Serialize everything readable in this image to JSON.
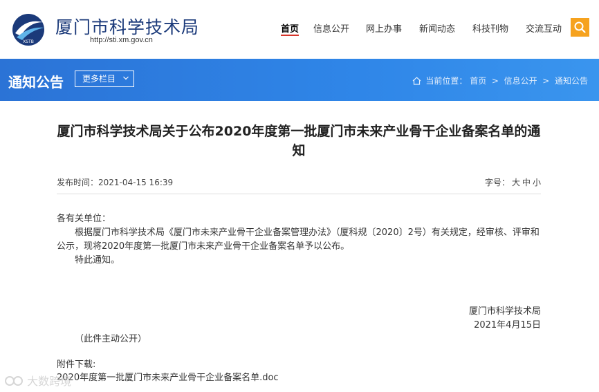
{
  "header": {
    "site_title": "厦门市科学技术局",
    "site_url": "http://sti.xm.gov.cn",
    "logo_text": "XSTB",
    "nav": [
      {
        "label": "首页",
        "active": true
      },
      {
        "label": "信息公开",
        "active": false
      },
      {
        "label": "网上办事",
        "active": false
      },
      {
        "label": "新闻动态",
        "active": false
      },
      {
        "label": "科技刊物",
        "active": false
      },
      {
        "label": "交流互动",
        "active": false
      }
    ],
    "search_icon": "search-icon",
    "accent_color": "#f6a21e",
    "active_underline_color": "#d6342a"
  },
  "banner": {
    "title": "通知公告",
    "more_label": "更多栏目",
    "breadcrumb_prefix": "当前位置：",
    "breadcrumb": [
      "首页",
      "信息公开",
      "通知公告"
    ],
    "separator": ">",
    "color": "#2f86e8"
  },
  "article": {
    "title": "厦门市科学技术局关于公布2020年度第一批厦门市未来产业骨干企业备案名单的通知",
    "publish_time": "发布时间：2021-04-15 16:39",
    "font_size_label": "字号：",
    "font_sizes": [
      "大",
      "中",
      "小"
    ],
    "salutation": "各有关单位：",
    "paragraph_1": "根据厦门市科学技术局《厦门市未来产业骨干企业备案管理办法》（厦科规〔2020〕2号）有关规定，经审核、评审和公示，现将2020年度第一批厦门市未来产业骨干企业备案名单予以公布。",
    "paragraph_2": "特此通知。",
    "signature_org": "厦门市科学技术局",
    "signature_date": "2021年4月15日",
    "public_note": "（此件主动公开）",
    "attachment_label": "附件下载:",
    "attachment_file": "2020年度第一批厦门市未来产业骨干企业备案名单.doc"
  },
  "watermark": "大数跨境"
}
